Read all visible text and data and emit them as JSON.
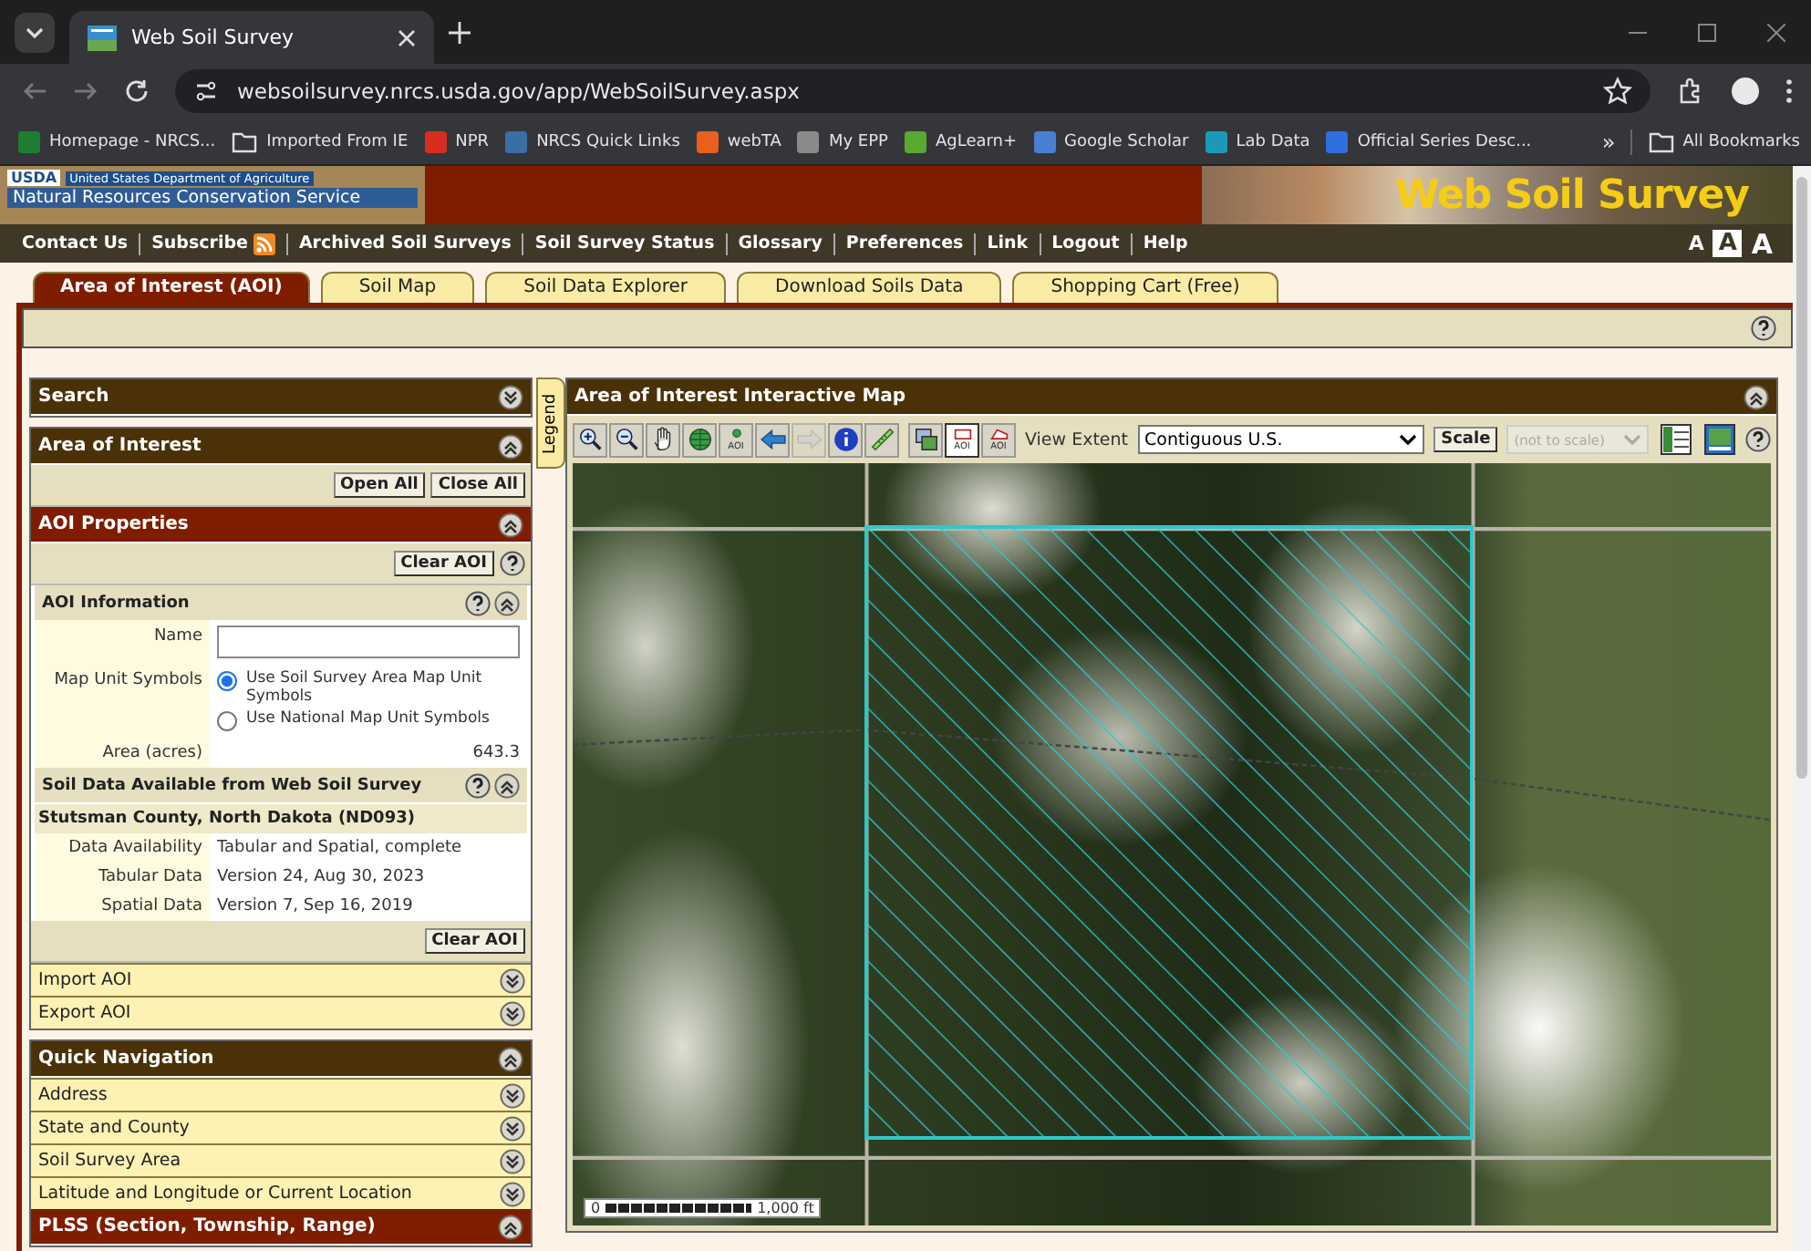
{
  "browser": {
    "tab_title": "Web Soil Survey",
    "url": "websoilsurvey.nrcs.usda.gov/app/WebSoilSurvey.aspx",
    "bookmarks": [
      {
        "kind": "site",
        "label": "Homepage - NRCS...",
        "color": "#1e7d32"
      },
      {
        "kind": "folder",
        "label": "Imported From IE"
      },
      {
        "kind": "site",
        "label": "NPR",
        "color": "#d62d20"
      },
      {
        "kind": "site",
        "label": "NRCS Quick Links",
        "color": "#3b6ea5"
      },
      {
        "kind": "site",
        "label": "webTA",
        "color": "#e8601c"
      },
      {
        "kind": "site",
        "label": "My EPP",
        "color": "#8a8a8a"
      },
      {
        "kind": "site",
        "label": "AgLearn+",
        "color": "#5aa832"
      },
      {
        "kind": "site",
        "label": "Google Scholar",
        "color": "#4a7fd4"
      },
      {
        "kind": "site",
        "label": "Lab Data",
        "color": "#1b9ab8"
      },
      {
        "kind": "site",
        "label": "Official Series Desc...",
        "color": "#2f6fe0"
      }
    ],
    "overflow": "»",
    "all_bookmarks": "All Bookmarks"
  },
  "header": {
    "agency_logo": "USDA",
    "department": "United States Department of Agriculture",
    "service": "Natural Resources Conservation Service",
    "title": "Web Soil Survey"
  },
  "nav": [
    {
      "label": "Contact Us",
      "rss": false
    },
    {
      "label": "Subscribe",
      "rss": true
    },
    {
      "label": "Archived Soil Surveys",
      "rss": false
    },
    {
      "label": "Soil Survey Status",
      "rss": false
    },
    {
      "label": "Glossary",
      "rss": false
    },
    {
      "label": "Preferences",
      "rss": false
    },
    {
      "label": "Link",
      "rss": false
    },
    {
      "label": "Logout",
      "rss": false
    },
    {
      "label": "Help",
      "rss": false
    }
  ],
  "font_sizes": [
    {
      "label": "A",
      "selected": false
    },
    {
      "label": "A",
      "selected": true
    },
    {
      "label": "A",
      "selected": false
    }
  ],
  "tabs": [
    {
      "label": "Area of Interest (AOI)",
      "selected": true
    },
    {
      "label": "Soil Map",
      "selected": false
    },
    {
      "label": "Soil Data Explorer",
      "selected": false
    },
    {
      "label": "Download Soils Data",
      "selected": false
    },
    {
      "label": "Shopping Cart (Free)",
      "selected": false
    }
  ],
  "left": [
    {
      "rows": [
        {
          "kind": "header",
          "title": "Search",
          "expanded": false
        }
      ]
    },
    {
      "rows": [
        {
          "kind": "header",
          "title": "Area of Interest",
          "expanded": true
        },
        {
          "kind": "buttons",
          "buttons": [
            "Open All",
            "Close All"
          ],
          "help": false
        },
        {
          "kind": "group",
          "title": "AOI Properties",
          "expanded": true
        },
        {
          "kind": "buttons",
          "buttons": [
            "Clear AOI"
          ],
          "help": true
        },
        {
          "kind": "subheader",
          "title": "AOI Information",
          "expanded": true
        },
        {
          "kind": "field",
          "label": "Name"
        },
        {
          "kind": "radios",
          "label": "Map Unit Symbols",
          "options": [
            {
              "label": "Use Soil Survey Area Map Unit Symbols",
              "selected": true
            },
            {
              "label": "Use National Map Unit Symbols",
              "selected": false
            }
          ]
        },
        {
          "kind": "amount",
          "label": "Area (acres)",
          "value": "643.3"
        },
        {
          "kind": "subheader",
          "title": "Soil Data Available from Web Soil Survey",
          "expanded": true
        },
        {
          "kind": "caption",
          "title": "Stutsman County, North Dakota (ND093)"
        },
        {
          "kind": "pair",
          "label": "Data Availability",
          "value": "Tabular and Spatial, complete"
        },
        {
          "kind": "pair",
          "label": "Tabular Data",
          "value": "Version 24, Aug 30, 2023"
        },
        {
          "kind": "pair",
          "label": "Spatial Data",
          "value": "Version 7, Sep 16, 2019"
        },
        {
          "kind": "buttons",
          "buttons": [
            "Clear AOI"
          ],
          "help": false
        },
        {
          "kind": "item",
          "title": "Import AOI",
          "expanded": false
        },
        {
          "kind": "item",
          "title": "Export AOI",
          "expanded": false
        }
      ]
    },
    {
      "rows": [
        {
          "kind": "header",
          "title": "Quick Navigation",
          "expanded": true
        },
        {
          "kind": "item",
          "title": "Address",
          "expanded": false
        },
        {
          "kind": "item",
          "title": "State and County",
          "expanded": false
        },
        {
          "kind": "item",
          "title": "Soil Survey Area",
          "expanded": false
        },
        {
          "kind": "item",
          "title": "Latitude and Longitude or Current Location",
          "expanded": false
        },
        {
          "kind": "group",
          "title": "PLSS (Section, Township, Range)",
          "expanded": true
        }
      ]
    }
  ],
  "map": {
    "title": "Area of Interest Interactive Map",
    "expanded": true,
    "legend": "Legend",
    "tools": [
      {
        "kind": "zoom-in",
        "selected": false,
        "disabled": false
      },
      {
        "kind": "zoom-out",
        "selected": false,
        "disabled": false
      },
      {
        "kind": "pan",
        "selected": false,
        "disabled": false
      },
      {
        "kind": "globe",
        "selected": false,
        "disabled": false
      },
      {
        "kind": "aoi-point",
        "label": "AOI",
        "selected": false,
        "disabled": false
      },
      {
        "kind": "back",
        "selected": false,
        "disabled": false
      },
      {
        "kind": "forward",
        "selected": false,
        "disabled": true
      },
      {
        "kind": "info",
        "selected": false,
        "disabled": false
      },
      {
        "kind": "ruler",
        "selected": false,
        "disabled": false
      }
    ],
    "aoi_tools": [
      {
        "kind": "layers",
        "selected": false,
        "disabled": false
      },
      {
        "kind": "aoi-rect",
        "label": "AOI",
        "selected": true,
        "disabled": false
      },
      {
        "kind": "aoi-polygon",
        "label": "AOI",
        "selected": false,
        "disabled": false
      }
    ],
    "view_extent_label": "View Extent",
    "view_extent": "Contiguous U.S.",
    "scale_button": "Scale",
    "scale_select": {
      "value": "(not to scale)",
      "disabled": true
    },
    "view_tools": [
      {
        "kind": "layout"
      },
      {
        "kind": "map-window"
      }
    ],
    "scale_bar": {
      "start": "0",
      "end": "1,000 ft"
    }
  }
}
